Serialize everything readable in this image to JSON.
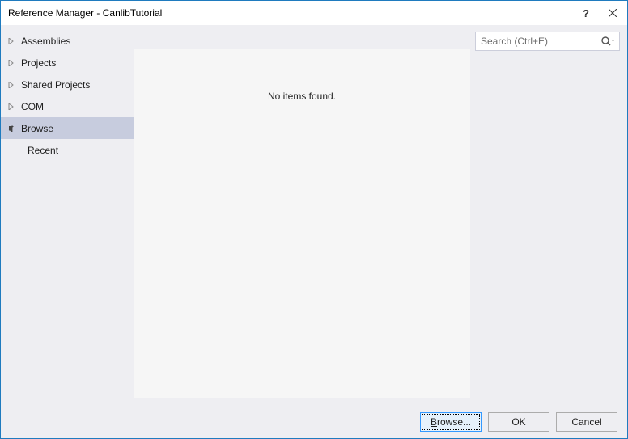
{
  "window": {
    "title": "Reference Manager - CanlibTutorial"
  },
  "sidebar": {
    "items": [
      {
        "label": "Assemblies",
        "expanded": false,
        "selected": false
      },
      {
        "label": "Projects",
        "expanded": false,
        "selected": false
      },
      {
        "label": "Shared Projects",
        "expanded": false,
        "selected": false
      },
      {
        "label": "COM",
        "expanded": false,
        "selected": false
      },
      {
        "label": "Browse",
        "expanded": true,
        "selected": true
      }
    ],
    "subitems": [
      {
        "label": "Recent"
      }
    ]
  },
  "content": {
    "empty_message": "No items found."
  },
  "search": {
    "placeholder": "Search (Ctrl+E)",
    "value": ""
  },
  "footer": {
    "browse_prefix": "B",
    "browse_suffix": "rowse...",
    "ok": "OK",
    "cancel": "Cancel"
  }
}
